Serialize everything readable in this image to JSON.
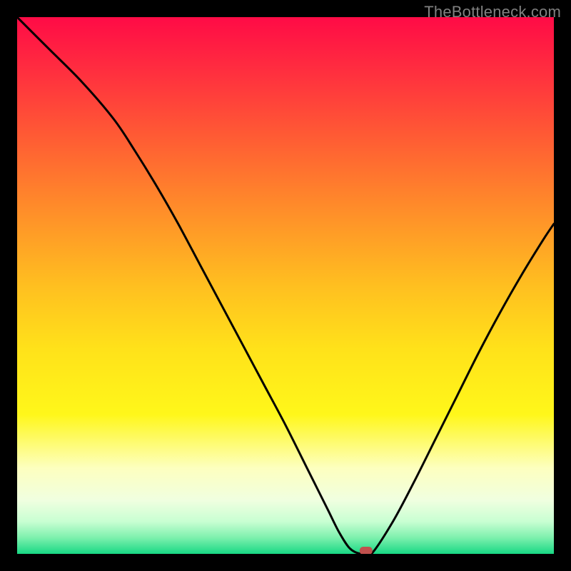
{
  "watermark": "TheBottleneck.com",
  "chart_data": {
    "type": "line",
    "title": "",
    "xlabel": "",
    "ylabel": "",
    "xlim": [
      0,
      100
    ],
    "ylim": [
      0,
      100
    ],
    "grid": false,
    "legend": false,
    "series": [
      {
        "name": "bottleneck-curve",
        "x": [
          0,
          6,
          12,
          18,
          22,
          26,
          30,
          34,
          38,
          42,
          46,
          50,
          54,
          56,
          58,
          60,
          62,
          64,
          66,
          70,
          74,
          78,
          82,
          86,
          90,
          94,
          98,
          100
        ],
        "y": [
          100,
          94,
          88,
          81,
          75,
          68.5,
          61.5,
          54,
          46.5,
          39,
          31.5,
          24,
          16,
          12,
          8,
          4,
          1,
          0,
          0,
          6,
          13.5,
          21.5,
          29.5,
          37.5,
          45,
          52,
          58.5,
          61.5
        ]
      }
    ],
    "marker": {
      "x": 65,
      "y": 0.6,
      "color": "#c0504d"
    },
    "background_gradient": {
      "stops": [
        {
          "offset": 0.0,
          "color": "#ff0b46"
        },
        {
          "offset": 0.1,
          "color": "#ff2e3f"
        },
        {
          "offset": 0.22,
          "color": "#ff5a34"
        },
        {
          "offset": 0.35,
          "color": "#ff8a2a"
        },
        {
          "offset": 0.5,
          "color": "#ffbf20"
        },
        {
          "offset": 0.62,
          "color": "#ffe21a"
        },
        {
          "offset": 0.74,
          "color": "#fff71a"
        },
        {
          "offset": 0.84,
          "color": "#fdffbf"
        },
        {
          "offset": 0.9,
          "color": "#f0ffe0"
        },
        {
          "offset": 0.94,
          "color": "#c8ffd2"
        },
        {
          "offset": 0.97,
          "color": "#7df0ad"
        },
        {
          "offset": 1.0,
          "color": "#18d884"
        }
      ]
    }
  }
}
